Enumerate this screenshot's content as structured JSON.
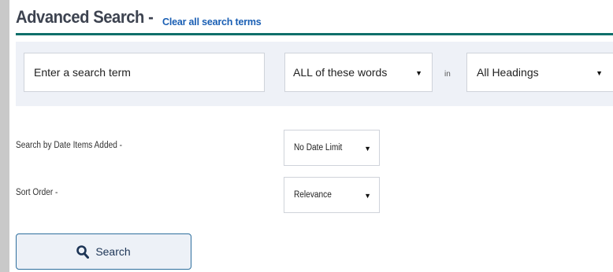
{
  "header": {
    "title": "Advanced Search -",
    "clear_link": "Clear all search terms"
  },
  "search": {
    "term_placeholder": "Enter a search term",
    "match_mode": "ALL of these words",
    "in_label": "in",
    "field": "All Headings",
    "caret": "▼"
  },
  "filters": {
    "date_label": "Search by Date Items Added -",
    "date_value": "No Date Limit",
    "sort_label": "Sort Order -",
    "sort_value": "Relevance"
  },
  "actions": {
    "search_label": "Search",
    "search_icon": "magnifier-icon"
  },
  "colors": {
    "accent_rule": "#0f6f6a",
    "link": "#1a5fb4",
    "band": "#eef1f7"
  }
}
